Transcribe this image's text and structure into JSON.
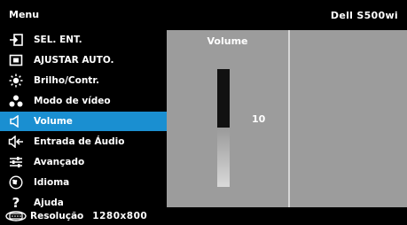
{
  "header": {
    "title": "Menu",
    "model": "Dell S500wi"
  },
  "menu": {
    "items": [
      {
        "label": "SEL. ENT.",
        "icon": "input-select-icon"
      },
      {
        "label": "AJUSTAR AUTO.",
        "icon": "auto-adjust-icon"
      },
      {
        "label": "Brilho/Contr.",
        "icon": "brightness-icon"
      },
      {
        "label": "Modo de vídeo",
        "icon": "video-mode-icon"
      },
      {
        "label": "Volume",
        "icon": "speaker-icon",
        "selected": true
      },
      {
        "label": "Entrada de Áudio",
        "icon": "audio-input-icon"
      },
      {
        "label": "Avançado",
        "icon": "advanced-settings-icon"
      },
      {
        "label": "Idioma",
        "icon": "language-icon"
      },
      {
        "label": "Ajuda",
        "icon": "help-icon"
      }
    ]
  },
  "volume_panel": {
    "title": "Volume",
    "value": "10",
    "level_fraction": 0.5
  },
  "footer": {
    "resolution_label": "Resolução",
    "resolution_value": "1280x800"
  },
  "colors": {
    "selected": "#1a8fd1",
    "panel": "#9c9c9c"
  }
}
